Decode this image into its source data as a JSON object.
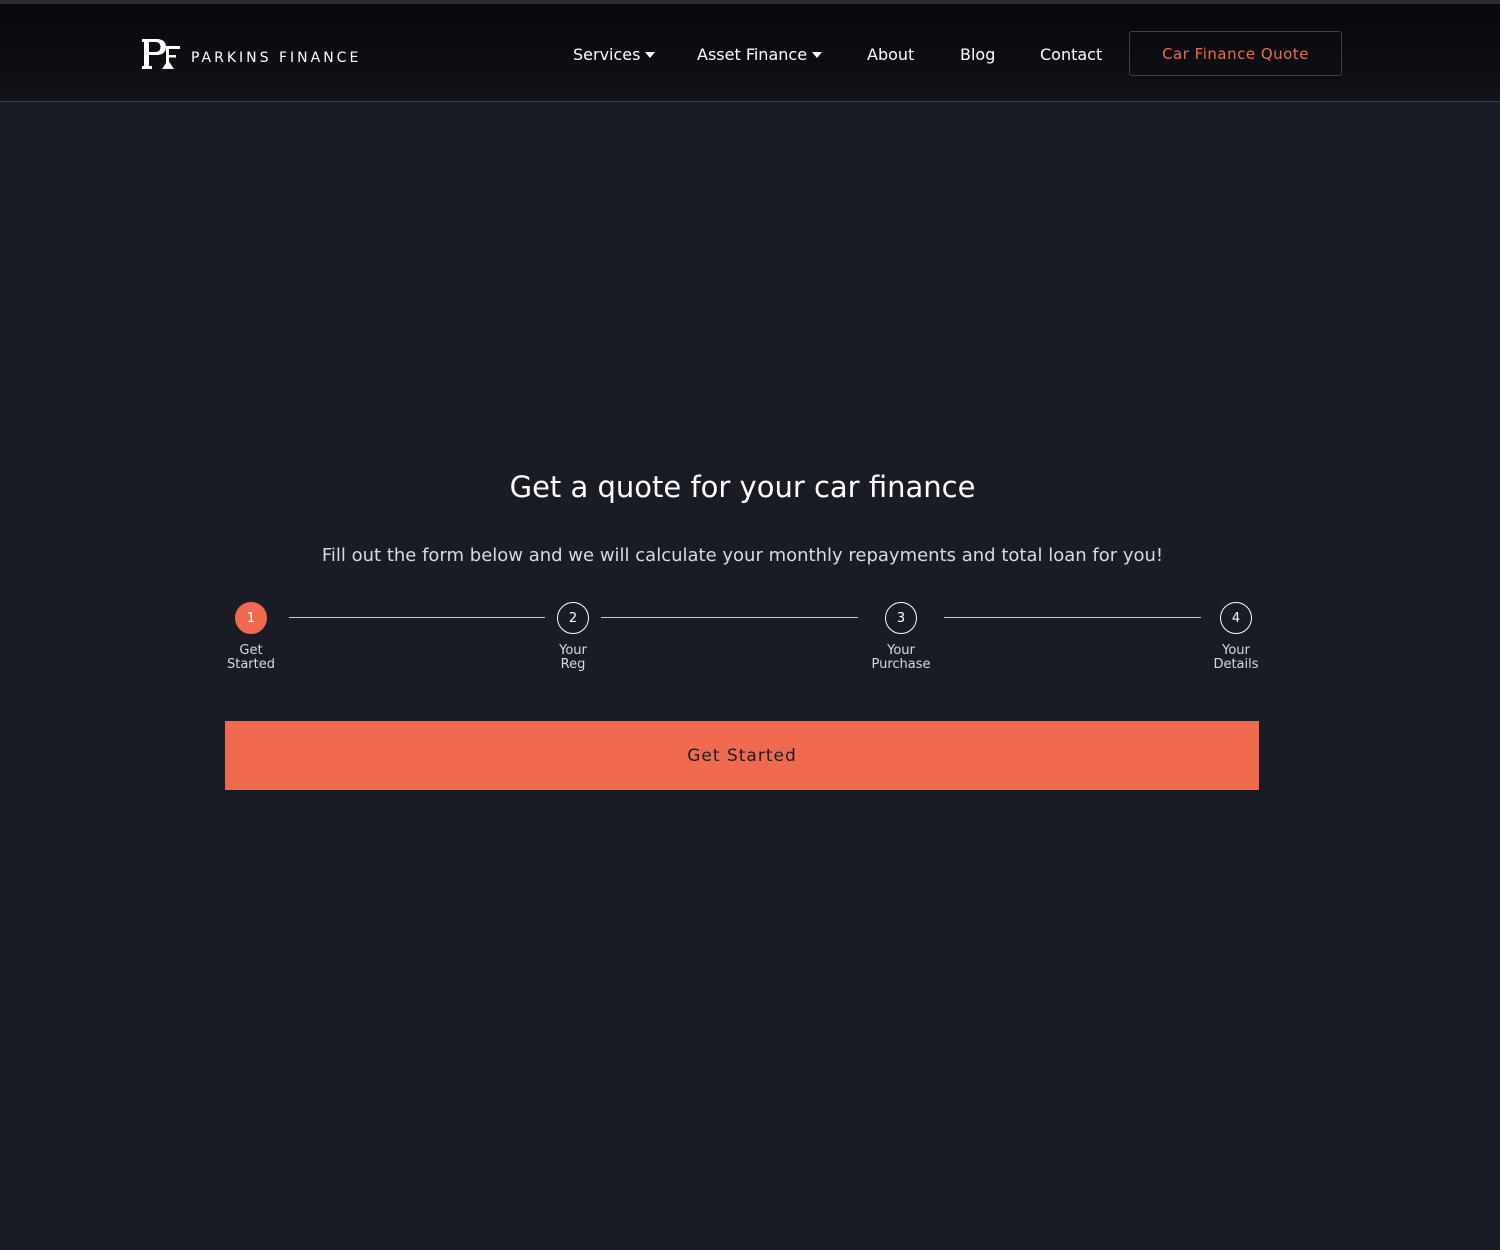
{
  "header": {
    "logo": {
      "text": "PARKINS FINANCE",
      "mark": "PF"
    },
    "nav": [
      {
        "label": "Services",
        "has_dropdown": true
      },
      {
        "label": "Asset Finance",
        "has_dropdown": true
      },
      {
        "label": "About",
        "has_dropdown": false
      },
      {
        "label": "Blog",
        "has_dropdown": false
      },
      {
        "label": "Contact",
        "has_dropdown": false
      }
    ],
    "cta_label": "Car Finance Quote"
  },
  "main": {
    "title": "Get a quote for your car finance",
    "subtitle": "Fill out the form below and we will calculate your monthly repayments and total loan for you!",
    "steps": [
      {
        "number": "1",
        "line1": "Get",
        "line2": "Started",
        "active": true
      },
      {
        "number": "2",
        "line1": "Your",
        "line2": "Reg",
        "active": false
      },
      {
        "number": "3",
        "line1": "Your",
        "line2": "Purchase",
        "active": false
      },
      {
        "number": "4",
        "line1": "Your",
        "line2": "Details",
        "active": false
      }
    ],
    "current_step": 1,
    "button_label": "Get Started"
  },
  "colors": {
    "background": "#1a1c25",
    "header": "#0b0d12",
    "accent": "#f06a4f",
    "text": "#ffffff",
    "muted_text": "#d9dbe0"
  }
}
